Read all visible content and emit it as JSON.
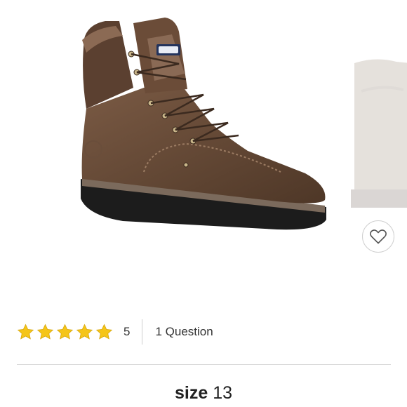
{
  "product": {
    "image_alt": "Brown leather lace-up work boot with black wedge sole",
    "next_image_alt": "Partial view of next product image",
    "favorite_icon": "heart-outline-icon"
  },
  "rating": {
    "stars": 5,
    "max_stars": 5,
    "star_color": "#f5c518",
    "count": "5",
    "questions": "1 Question"
  },
  "size": {
    "label": "size",
    "value": "13"
  }
}
